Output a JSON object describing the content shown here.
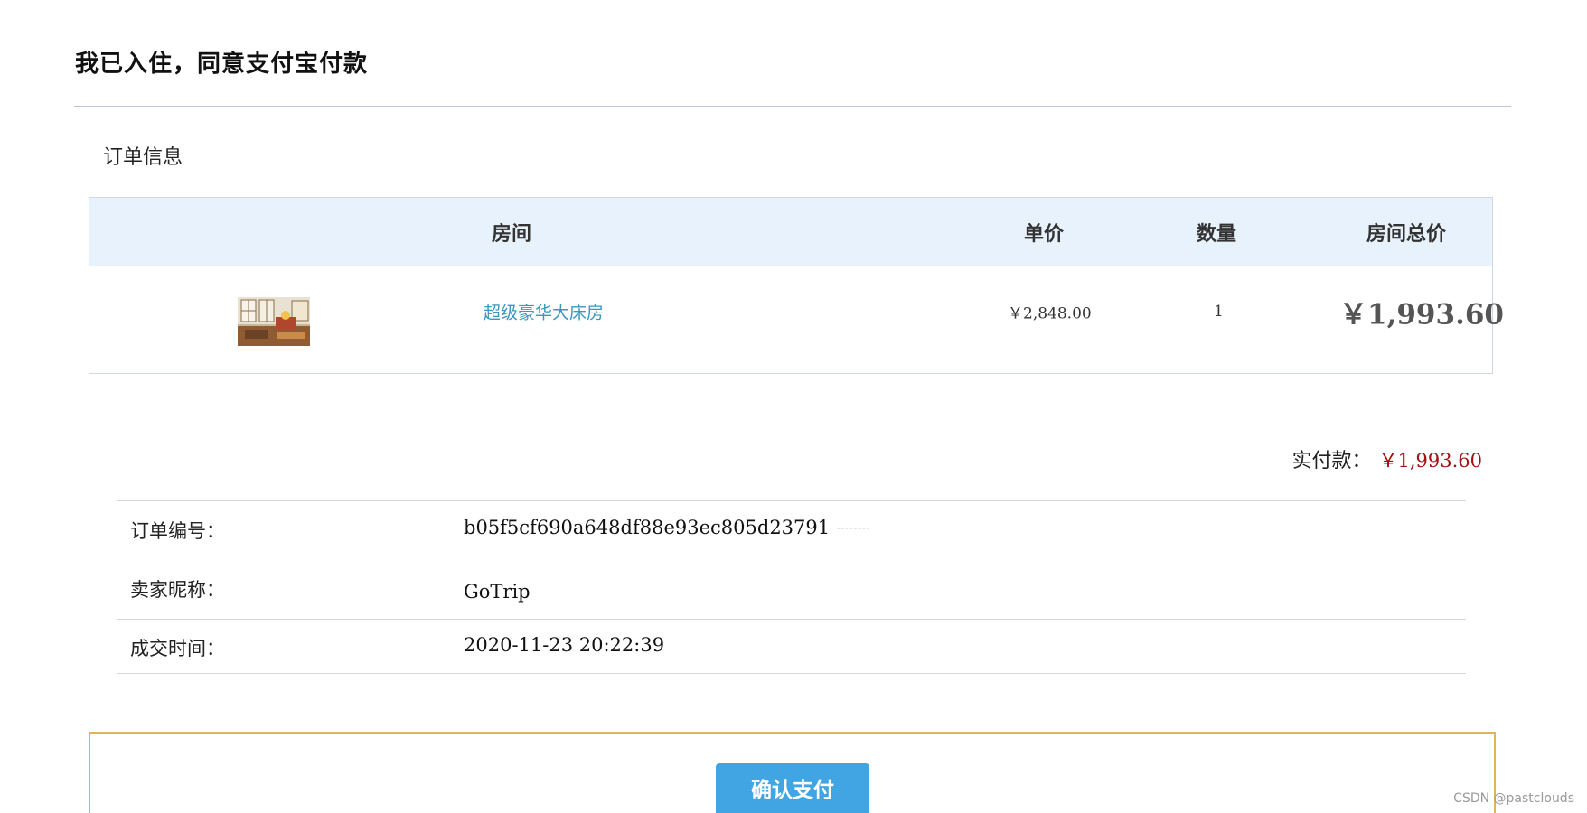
{
  "header": {
    "title": "我已入住，同意支付宝付款"
  },
  "order_section": {
    "label": "订单信息"
  },
  "order_table": {
    "columns": {
      "room": "房间",
      "unit_price": "单价",
      "quantity": "数量",
      "room_total": "房间总价"
    },
    "rows": [
      {
        "room_name": "超级豪华大床房",
        "unit_price": "￥2,848.00",
        "quantity": "1",
        "room_total": "￥1,993.60"
      }
    ]
  },
  "payment": {
    "label": "实付款：",
    "amount": "￥1,993.60"
  },
  "info": {
    "order_no_label": "订单编号：",
    "order_no": "b05f5cf690a648df88e93ec805d23791",
    "seller_label": "卖家昵称：",
    "seller": "GoTrip",
    "time_label": "成交时间：",
    "time": "2020-11-23 20:22:39"
  },
  "actions": {
    "confirm_label": "确认支付"
  },
  "watermark": "CSDN @pastclouds",
  "colors": {
    "link": "#3a97bd",
    "price_red": "#a30f14",
    "header_bg": "#e8f2fc",
    "button_bg": "#42a5e3",
    "box_border": "#e0b458"
  }
}
